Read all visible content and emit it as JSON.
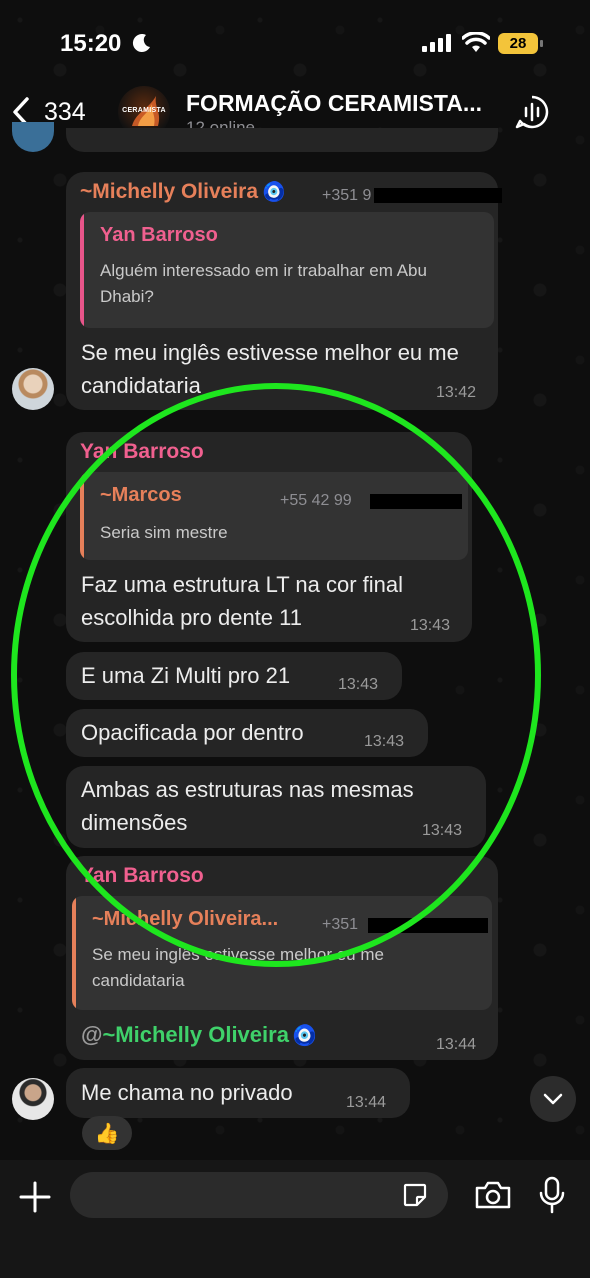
{
  "status_bar": {
    "time": "15:20",
    "battery": "28"
  },
  "header": {
    "back_count": "334",
    "avatar_text": "CERAMISTA",
    "title": "FORMAÇÃO CERAMISTA...",
    "subtitle": "12 online"
  },
  "messages": [
    {
      "author": "~Michelly Oliveira",
      "author_emoji": "🧿",
      "phone": "+351 9",
      "reply_author": "Yan Barroso",
      "reply_text": "Alguém interessado em ir trabalhar em Abu Dhabi?",
      "text": "Se meu inglês estivesse melhor eu me candidataria",
      "time": "13:42"
    },
    {
      "author": "Yan Barroso",
      "reply_author": "~Marcos",
      "reply_phone": "+55 42 99",
      "reply_text": "Seria sim mestre",
      "text": "Faz uma estrutura LT na cor final escolhida pro dente 11",
      "time": "13:43"
    },
    {
      "text": "E uma Zi Multi pro 21",
      "time": "13:43"
    },
    {
      "text": "Opacificada por dentro",
      "time": "13:43"
    },
    {
      "text": "Ambas as estruturas nas mesmas dimensões",
      "time": "13:43"
    },
    {
      "author": "Yan Barroso",
      "reply_author": "~Michelly Oliveira...",
      "reply_phone": "+351",
      "reply_text": "Se meu inglês estivesse melhor eu me candidataria",
      "mention_at": "@",
      "mention_name": "~Michelly Oliveira",
      "mention_emoji": "🧿",
      "time": "13:44"
    },
    {
      "text": "Me chama no privado",
      "time": "13:44",
      "reaction": "👍"
    }
  ],
  "input": {
    "placeholder": ""
  },
  "colors": {
    "highlight": "#1ee61e",
    "author_pink": "#f0608f",
    "author_orange": "#e6805a",
    "mention_green": "#3fd16a"
  },
  "icons": [
    "moon-icon",
    "signal-icon",
    "wifi-icon",
    "back-chevron-icon",
    "voice-chat-icon",
    "chevron-down-icon",
    "plus-icon",
    "sticker-icon",
    "camera-icon",
    "microphone-icon"
  ]
}
